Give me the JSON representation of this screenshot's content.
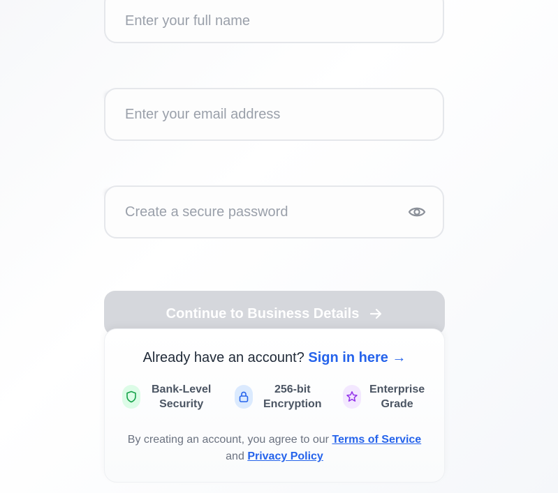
{
  "form": {
    "name_placeholder": "Enter your full name",
    "email_placeholder": "Enter your email address",
    "password_placeholder": "Create a secure password",
    "password_toggle_icon": "eye-icon"
  },
  "cta": {
    "label": "Continue to Business Details",
    "icon": "arrow-right-icon",
    "background": "#d5d7dc"
  },
  "signin": {
    "prompt": "Already have an account?",
    "link": "Sign in here →"
  },
  "badges": [
    {
      "line1": "Bank-Level",
      "line2": "Security",
      "icon": "shield-icon",
      "color": "#16a34a",
      "bg": "#dcfce7"
    },
    {
      "line1": "256-bit",
      "line2": "Encryption",
      "icon": "lock-icon",
      "color": "#2563eb",
      "bg": "#dbeafe"
    },
    {
      "line1": "Enterprise",
      "line2": "Grade",
      "icon": "star-icon",
      "color": "#9333ea",
      "bg": "#f3e8ff"
    }
  ],
  "legal": {
    "prefix": "By creating an account, you agree to our",
    "terms": "Terms of Service",
    "and": "and",
    "privacy": "Privacy Policy"
  },
  "colors": {
    "accent": "#2563eb",
    "border": "#e5e7eb",
    "placeholder": "#9aa0aa"
  }
}
